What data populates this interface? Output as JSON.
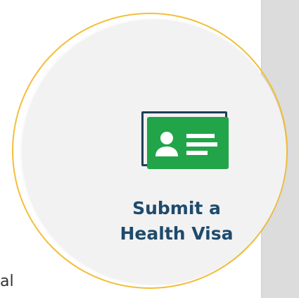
{
  "cta": {
    "title_line1": "Submit a",
    "title_line2": "Health Visa",
    "icon": "id-card-icon"
  },
  "left_clip": {
    "text": "al"
  },
  "colors": {
    "ring": "#f3bf3a",
    "card_bg": "#f2f2f2",
    "title": "#1f4a6b",
    "icon_green": "#22a449",
    "icon_outline": "#1f3f57",
    "side_panel": "#dcdcdc"
  }
}
